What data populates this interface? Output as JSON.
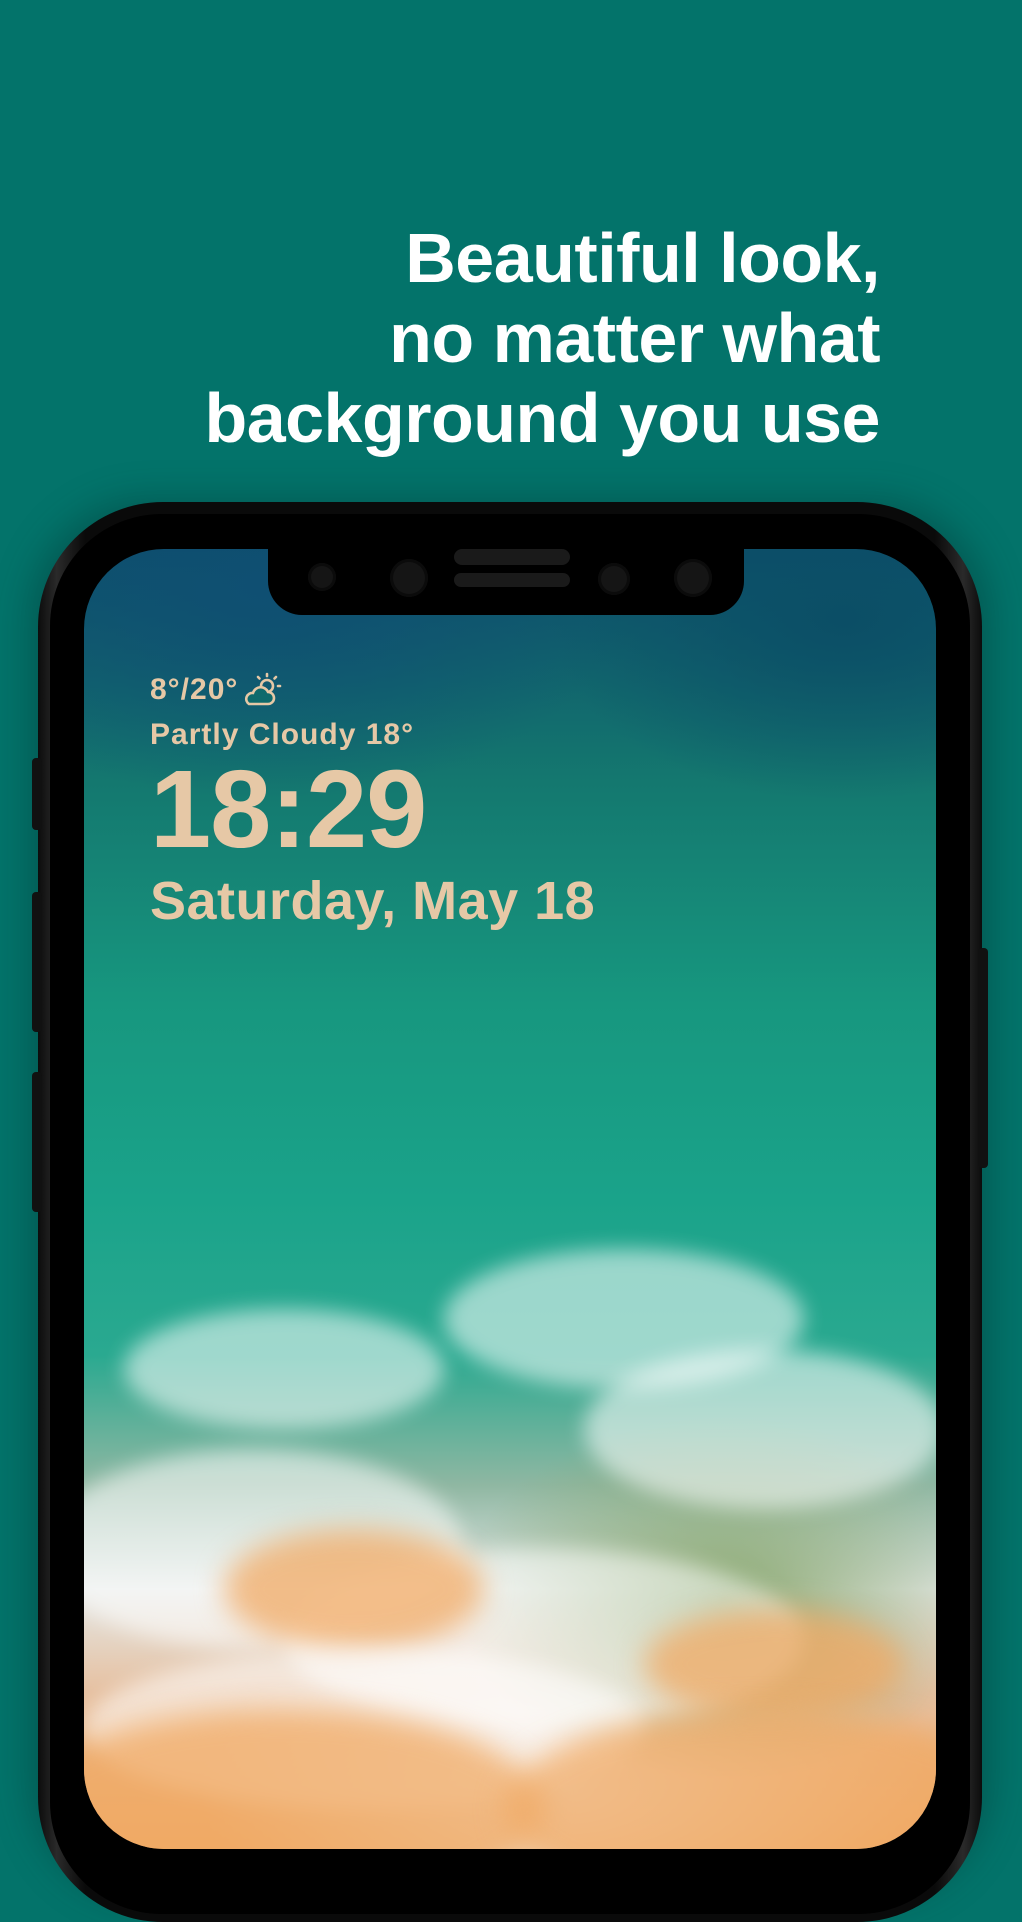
{
  "headline": {
    "line1": "Beautiful look,",
    "line2": "no matter what",
    "line3": "background you use"
  },
  "lock_screen": {
    "temperature_range": "8°/20°",
    "weather_icon": "partly-cloudy-icon",
    "condition": "Partly Cloudy 18°",
    "time": "18:29",
    "date": "Saturday, May 18"
  },
  "colors": {
    "background": "#03736a",
    "headline_text": "#ffffff",
    "lock_text": "#e6c8a6"
  }
}
